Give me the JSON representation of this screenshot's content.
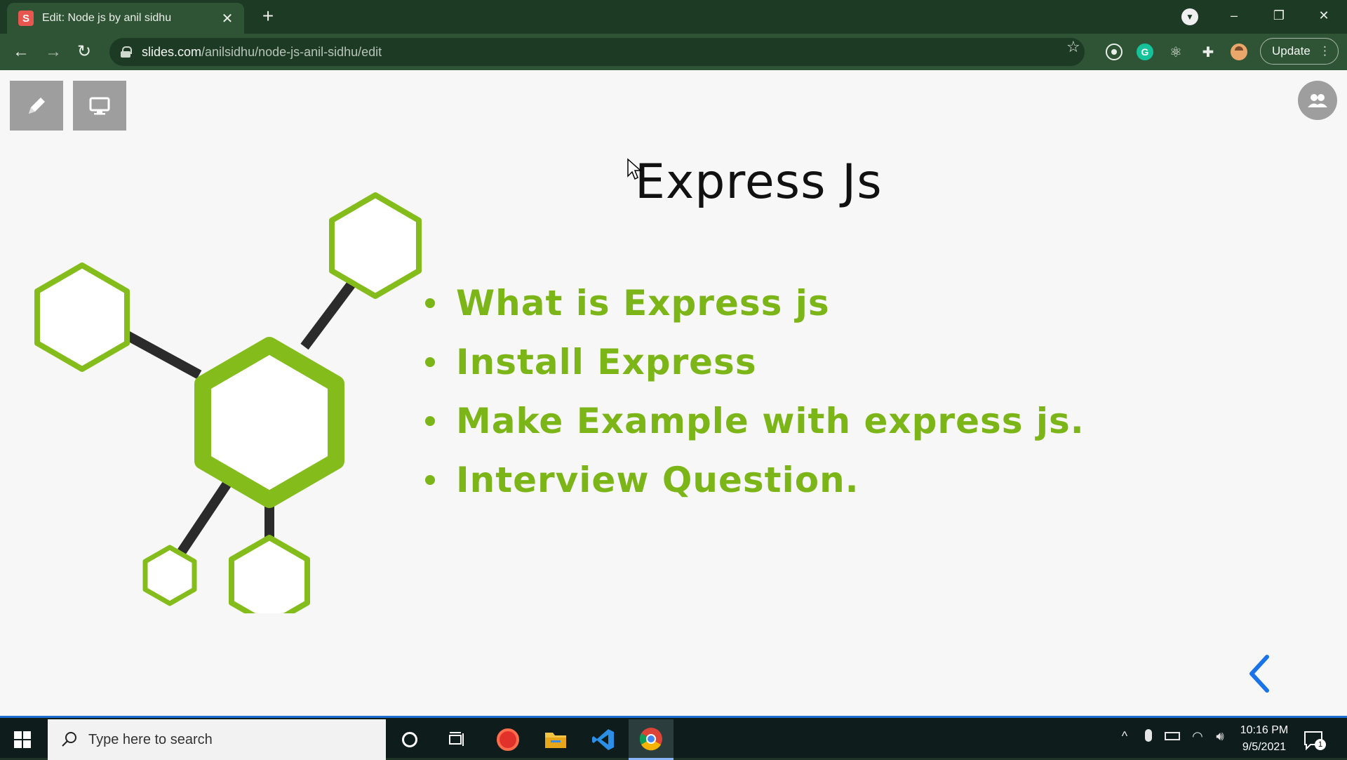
{
  "browser": {
    "tab_favicon_letter": "S",
    "tab_title": "Edit: Node js by anil sidhu",
    "tab_close": "✕",
    "new_tab": "+",
    "url_host": "slides.com",
    "url_path": "/anilsidhu/node-js-anil-sidhu/edit",
    "update_label": "Update",
    "extension_initial": "G"
  },
  "slide": {
    "title": "Express Js",
    "bullets": [
      "What is Express js",
      "Install Express",
      "Make Example with express js.",
      "Interview Question."
    ],
    "accent_color": "#7cb518"
  },
  "taskbar": {
    "search_placeholder": "Type here to search",
    "time": "10:16 PM",
    "date": "9/5/2021",
    "notification_count": "1"
  }
}
